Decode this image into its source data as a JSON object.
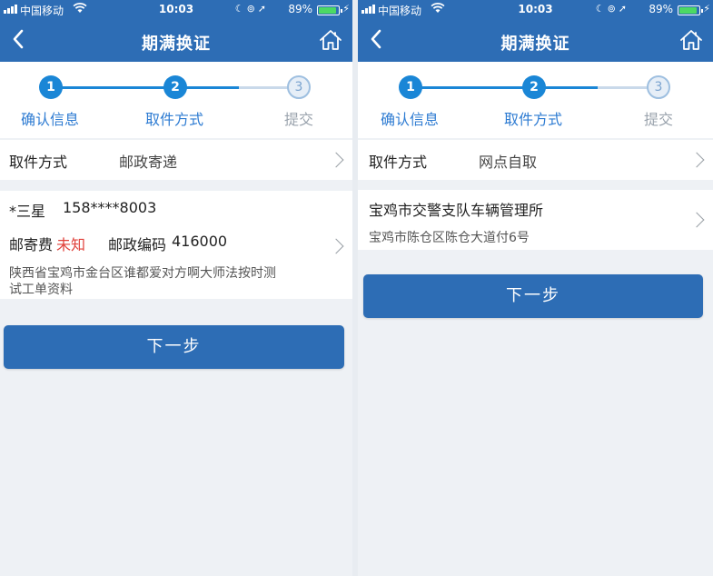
{
  "colors": {
    "nav_bg": "#2d6db5",
    "accent": "#1a86d6",
    "step_label": "#2d7bd2",
    "warning": "#e0403a",
    "page_bg": "#eef1f5",
    "button_bg": "#2d6db5"
  },
  "status_bar": {
    "carrier": "中国移动",
    "time": "10:03",
    "battery": "89%",
    "battery_level": 0.89,
    "icons": [
      "signal-icon",
      "wifi-icon",
      "moon-icon",
      "lock-rotation-icon",
      "location-icon",
      "battery-icon",
      "charging-icon"
    ]
  },
  "nav": {
    "title": "期满换证",
    "back_icon": "back-icon",
    "home_icon": "home-icon"
  },
  "steps": [
    {
      "num": "1",
      "label": "确认信息",
      "state": "done"
    },
    {
      "num": "2",
      "label": "取件方式",
      "state": "active"
    },
    {
      "num": "3",
      "label": "提交",
      "state": "todo"
    }
  ],
  "left": {
    "method": {
      "label": "取件方式",
      "value": "邮政寄递"
    },
    "recipient": {
      "name": "*三星",
      "phone": "158****8003"
    },
    "fee": {
      "label": "邮寄费",
      "value": "未知"
    },
    "postcode": {
      "label": "邮政编码",
      "value": "416000"
    },
    "address_line1": "陕西省宝鸡市金台区谁都爱对方啊大师法按时测",
    "address_line2": "试工单资料",
    "next_button": "下一步"
  },
  "right": {
    "method": {
      "label": "取件方式",
      "value": "网点自取"
    },
    "office": {
      "name": "宝鸡市交警支队车辆管理所",
      "address": "宝鸡市陈仓区陈仓大道付6号"
    },
    "next_button": "下一步"
  }
}
